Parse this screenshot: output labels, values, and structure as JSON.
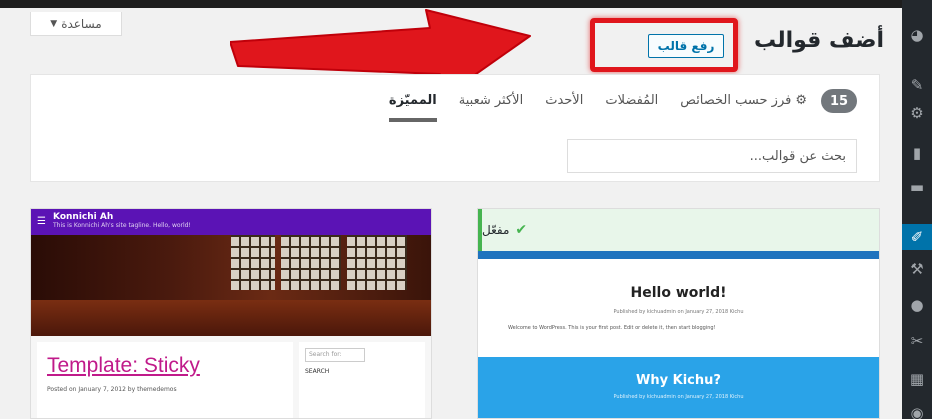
{
  "help_tab": {
    "label": "مساعدة",
    "caret": "▼"
  },
  "page": {
    "title": "أضف قوالب",
    "upload_button": "رفع قالب"
  },
  "filter": {
    "count": "15",
    "tabs": [
      {
        "label": "المميّزة",
        "current": true
      },
      {
        "label": "الأكثر شعبية"
      },
      {
        "label": "الأحدث"
      },
      {
        "label": "المُفضلات"
      }
    ],
    "feature_filter": "فرز حسب الخصائص",
    "search_placeholder": "بحث عن قوالب..."
  },
  "theme_left": {
    "site_title": "Konnichi Ah",
    "tagline": "This is Konnichi Ah's site tagline. Hello, world!",
    "post_title": "Template: Sticky",
    "post_meta": "Posted on January 7, 2012 by themedemos",
    "sidebar_search": "Search for:",
    "sidebar_button": "SEARCH"
  },
  "theme_right": {
    "active_label": "مفعّل",
    "hello_title": "Hello world!",
    "hello_meta": "Published by kichuadmin on January 27, 2018 Kichu",
    "hello_text": "Welcome to WordPress. This is your first post. Edit or delete it, then start blogging!",
    "why_title": "Why Kichu?",
    "why_meta": "Published by kichuadmin on January 27, 2018 Kichu"
  },
  "admin_menu": [
    "dashboard-icon",
    "pin-icon",
    "media-icon",
    "pages-icon",
    "comments-icon",
    "appearance-icon",
    "plugins-icon",
    "users-icon",
    "tools-icon",
    "settings-icon",
    "more-icon"
  ],
  "colors": {
    "annotation_red": "#e0161c",
    "wp_blue": "#0073aa",
    "admin_dark": "#23282d"
  }
}
